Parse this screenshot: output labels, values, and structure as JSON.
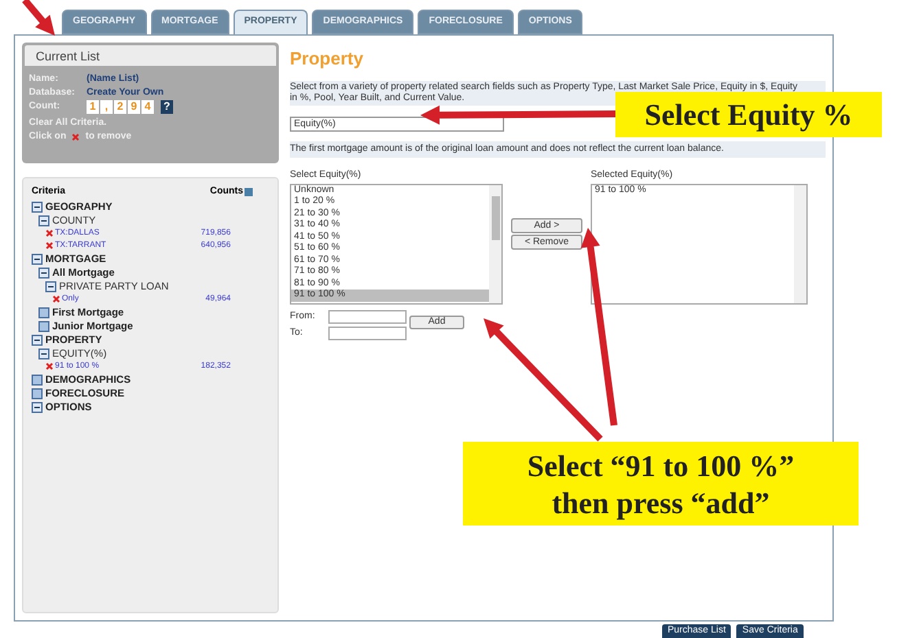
{
  "tabs": [
    {
      "label": "GEOGRAPHY",
      "selected": false
    },
    {
      "label": "MORTGAGE",
      "selected": false
    },
    {
      "label": "PROPERTY",
      "selected": true
    },
    {
      "label": "DEMOGRAPHICS",
      "selected": false
    },
    {
      "label": "FORECLOSURE",
      "selected": false
    },
    {
      "label": "OPTIONS",
      "selected": false
    }
  ],
  "current_list": {
    "title": "Current List",
    "name_label": "Name:",
    "name": "(Name List)",
    "database_label": "Database:",
    "database": "Create Your Own",
    "count_label": "Count:",
    "count_digits": [
      "1",
      ",",
      "2",
      "9",
      "4"
    ],
    "help": "?",
    "clear": "Clear All Criteria.",
    "remove_hint_before": "Click on",
    "remove_hint_after": "to remove"
  },
  "criteria": {
    "title": "Criteria",
    "counts_title": "Counts",
    "items": [
      {
        "kind": "category",
        "label": "GEOGRAPHY",
        "expanded": true,
        "children": [
          {
            "kind": "field",
            "label": "COUNTY",
            "expanded": true,
            "children": [
              {
                "kind": "value",
                "label": "TX:DALLAS",
                "count": "719,856"
              },
              {
                "kind": "value",
                "label": "TX:TARRANT",
                "count": "640,956"
              }
            ]
          }
        ]
      },
      {
        "kind": "category",
        "label": "MORTGAGE",
        "expanded": true,
        "children": [
          {
            "kind": "category",
            "label": "All Mortgage",
            "expanded": true,
            "children": [
              {
                "kind": "field",
                "label": "PRIVATE PARTY LOAN",
                "expanded": true,
                "children": [
                  {
                    "kind": "value",
                    "label": "Only",
                    "count": "49,964"
                  }
                ]
              }
            ]
          },
          {
            "kind": "category",
            "label": "First Mortgage",
            "expanded": false
          },
          {
            "kind": "category",
            "label": "Junior Mortgage",
            "expanded": false
          }
        ]
      },
      {
        "kind": "category",
        "label": "PROPERTY",
        "expanded": true,
        "children": [
          {
            "kind": "field",
            "label": "EQUITY(%)",
            "expanded": true,
            "children": [
              {
                "kind": "value",
                "label": "91 to 100 %",
                "count": "182,352"
              }
            ]
          }
        ]
      },
      {
        "kind": "category",
        "label": "DEMOGRAPHICS",
        "expanded": false
      },
      {
        "kind": "category",
        "label": "FORECLOSURE",
        "expanded": false
      },
      {
        "kind": "category",
        "label": "OPTIONS",
        "expanded": true
      }
    ]
  },
  "content": {
    "heading": "Property",
    "description": "Select from a variety of property related search fields such as Property Type, Last Market Sale Price, Equity in $, Equity in %, Pool, Year Built, and Current Value.",
    "field_select": "Equity(%)",
    "note": "The first mortgage amount is of the original loan amount and does not reflect the current loan balance.",
    "available_label": "Select Equity(%)",
    "available": [
      {
        "label": "Unknown",
        "selected": false
      },
      {
        "label": "1 to 20 %",
        "selected": false
      },
      {
        "label": "21 to 30 %",
        "selected": false
      },
      {
        "label": "31 to 40 %",
        "selected": false
      },
      {
        "label": "41 to 50 %",
        "selected": false
      },
      {
        "label": "51 to 60 %",
        "selected": false
      },
      {
        "label": "61 to 70 %",
        "selected": false
      },
      {
        "label": "71 to 80 %",
        "selected": false
      },
      {
        "label": "81 to 90 %",
        "selected": false
      },
      {
        "label": "91 to 100 %",
        "selected": true
      }
    ],
    "add_button": "Add >",
    "remove_button": "< Remove",
    "selected_label": "Selected Equity(%)",
    "selected": [
      "91 to 100 %"
    ],
    "from_label": "From:",
    "to_label": "To:",
    "range_add_button": "Add"
  },
  "footer_buttons": [
    "Purchase List",
    "Save Criteria"
  ],
  "callouts": [
    "Select Equity %",
    "Select “91 to 100 %” then press “add”"
  ]
}
